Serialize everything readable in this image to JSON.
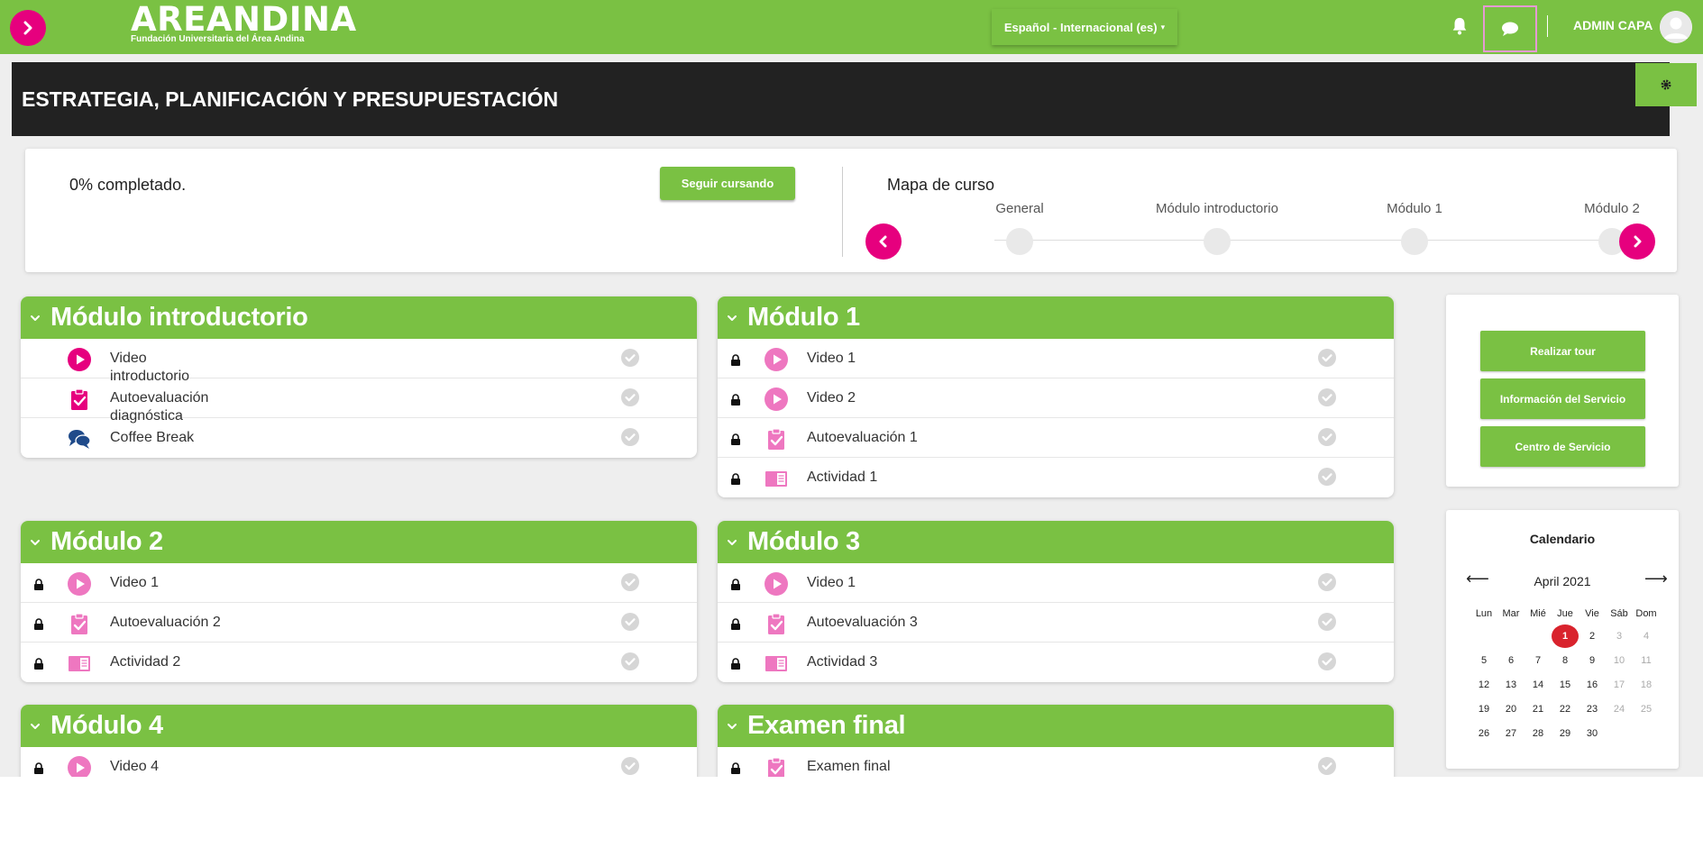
{
  "navbar": {
    "logo_word": "AREANDINA",
    "logo_sub": "Fundación Universitaria del Área Andina",
    "language": "Español - Internacional (es)",
    "user_name": "ADMIN CAPA",
    "accent_color": "#7ac143",
    "brand_pink": "#e6007e"
  },
  "header": {
    "title": "ESTRATEGIA, PLANIFICACIÓN Y PRESUPUESTACIÓN"
  },
  "progress": {
    "text": "0% completado.",
    "continue_label": "Seguir cursando",
    "map_title": "Mapa de curso",
    "steps": [
      "General",
      "Módulo introductorio",
      "Módulo 1",
      "Módulo 2"
    ]
  },
  "modules": [
    {
      "title": "Módulo introductorio",
      "activities": [
        {
          "label": "Video introductorio",
          "icon": "play-icon",
          "locked": false
        },
        {
          "label": "Autoevaluación diagnóstica",
          "icon": "clipboard-check-icon",
          "locked": false
        },
        {
          "label": "Coffee Break",
          "icon": "chat-bubbles-icon",
          "locked": false
        }
      ]
    },
    {
      "title": "Módulo 1",
      "activities": [
        {
          "label": "Video 1",
          "icon": "play-icon",
          "locked": true
        },
        {
          "label": "Video 2",
          "icon": "play-icon",
          "locked": true
        },
        {
          "label": "Autoevaluación 1",
          "icon": "clipboard-check-icon",
          "locked": true
        },
        {
          "label": "Actividad 1",
          "icon": "book-icon",
          "locked": true
        }
      ]
    },
    {
      "title": "Módulo 2",
      "activities": [
        {
          "label": "Video 1",
          "icon": "play-icon",
          "locked": true
        },
        {
          "label": "Autoevaluación 2",
          "icon": "clipboard-check-icon",
          "locked": true
        },
        {
          "label": "Actividad 2",
          "icon": "book-icon",
          "locked": true
        }
      ]
    },
    {
      "title": "Módulo 3",
      "activities": [
        {
          "label": "Video 1",
          "icon": "play-icon",
          "locked": true
        },
        {
          "label": "Autoevaluación 3",
          "icon": "clipboard-check-icon",
          "locked": true
        },
        {
          "label": "Actividad 3",
          "icon": "book-icon",
          "locked": true
        }
      ]
    },
    {
      "title": "Módulo 4",
      "activities": [
        {
          "label": "Video 4",
          "icon": "play-icon",
          "locked": true
        }
      ]
    },
    {
      "title": "Examen final",
      "activities": [
        {
          "label": "Examen final",
          "icon": "clipboard-check-icon",
          "locked": true
        }
      ]
    }
  ],
  "services": {
    "tour_label": "Realizar tour",
    "info_label": "Información del Servicio",
    "center_label": "Centro de Servicio"
  },
  "calendar": {
    "title": "Calendario",
    "month": "April 2021",
    "prev": "⟵",
    "next": "⟶",
    "weekdays": [
      "Lun",
      "Mar",
      "Mié",
      "Jue",
      "Vie",
      "Sáb",
      "Dom"
    ],
    "weeks": [
      [
        "",
        "",
        "",
        "1",
        "2",
        "3",
        "4"
      ],
      [
        "5",
        "6",
        "7",
        "8",
        "9",
        "10",
        "11"
      ],
      [
        "12",
        "13",
        "14",
        "15",
        "16",
        "17",
        "18"
      ],
      [
        "19",
        "20",
        "21",
        "22",
        "23",
        "24",
        "25"
      ],
      [
        "26",
        "27",
        "28",
        "29",
        "30",
        "",
        ""
      ]
    ],
    "today": "1"
  }
}
